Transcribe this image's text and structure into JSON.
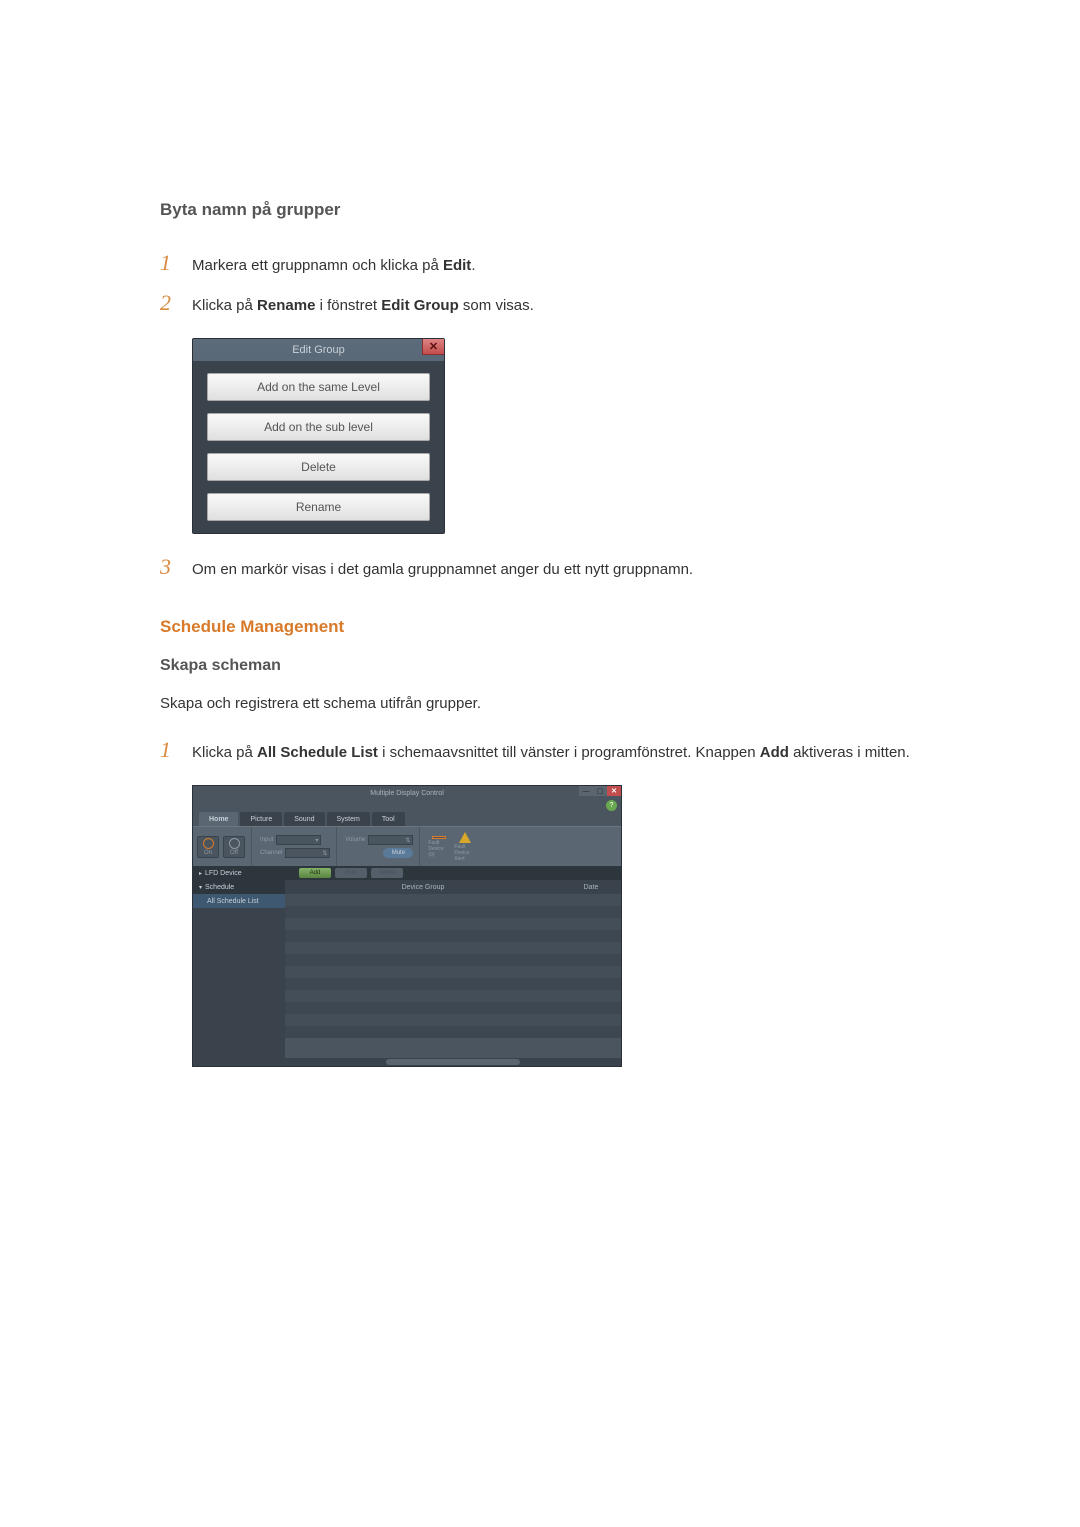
{
  "section1": {
    "title": "Byta namn på grupper",
    "steps": [
      {
        "prefix": "Markera ett gruppnamn och klicka på ",
        "bold1": "Edit",
        "rest": "."
      },
      {
        "prefix": "Klicka på ",
        "bold1": "Rename",
        "mid": " i fönstret ",
        "bold2": "Edit Group",
        "rest": " som visas."
      }
    ],
    "step3": "Om en markör visas i det gamla gruppnamnet anger du ett nytt gruppnamn."
  },
  "dialog": {
    "title": "Edit Group",
    "close": "✕",
    "buttons": [
      "Add on the same Level",
      "Add on the sub level",
      "Delete",
      "Rename"
    ]
  },
  "section2": {
    "heading": "Schedule Management",
    "subheading": "Skapa scheman",
    "body": "Skapa och registrera ett schema utifrån grupper.",
    "step1": {
      "prefix": "Klicka på ",
      "bold1": "All Schedule List",
      "mid": " i schemaavsnittet till vänster i programfönstret. Knappen ",
      "bold2": "Add",
      "rest": " aktiveras i mitten."
    }
  },
  "app": {
    "title": "Multiple Display Control",
    "tabs": [
      "Home",
      "Picture",
      "Sound",
      "System",
      "Tool"
    ],
    "ribbon": {
      "on": "On",
      "off": "Off",
      "input": "Input",
      "channel": "Channel",
      "volume": "Volume",
      "mute": "Mute",
      "fault_info": "Fault Device (0)",
      "fault_alert": "Fault Device Alert"
    },
    "sidebar": {
      "lfd": "LFD Device",
      "schedule": "Schedule",
      "all_list": "All Schedule List"
    },
    "toolbar": {
      "add": "Add",
      "edit": "Edit",
      "delete": "Delete"
    },
    "table": {
      "group": "Device Group",
      "date": "Date"
    },
    "help": "?"
  },
  "nums": {
    "n1": "1",
    "n2": "2",
    "n3": "3"
  }
}
